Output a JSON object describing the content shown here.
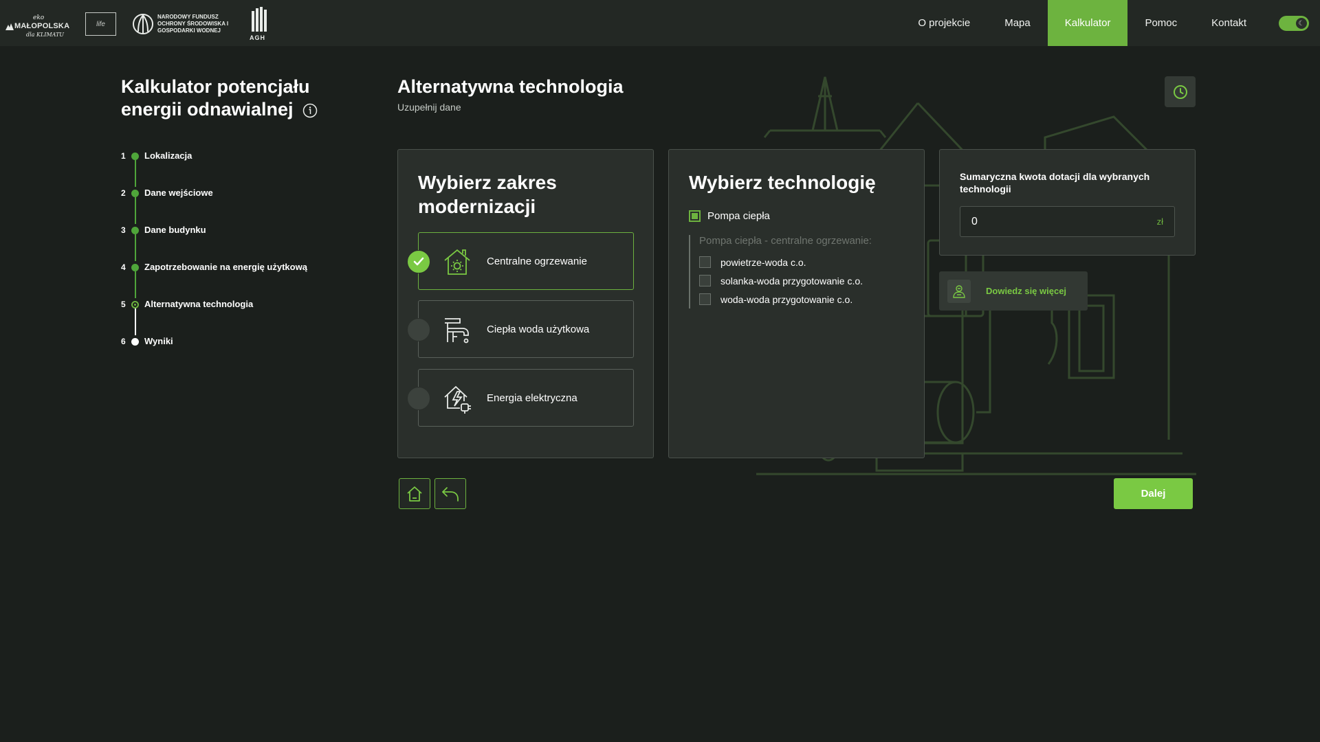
{
  "header": {
    "logos": {
      "malopolska_eko": "eko",
      "malopolska_main": "MAŁOPOLSKA",
      "malopolska_sub": "dla KLIMATU",
      "eu_text": "life",
      "nfos_text": "NARODOWY FUNDUSZ OCHRONY ŚRODOWISKA I GOSPODARKI WODNEJ",
      "agh": "AGH"
    },
    "nav": [
      {
        "label": "O projekcie",
        "active": false
      },
      {
        "label": "Mapa",
        "active": false
      },
      {
        "label": "Kalkulator",
        "active": true
      },
      {
        "label": "Pomoc",
        "active": false
      },
      {
        "label": "Kontakt",
        "active": false
      }
    ],
    "theme_toggle_icon": "moon-icon",
    "theme_toggle_glyph": "☾"
  },
  "sidebar": {
    "title": "Kalkulator potencjału energii odnawialnej",
    "info_icon": "info-icon",
    "steps": [
      {
        "num": "1",
        "label": "Lokalizacja",
        "state": "done"
      },
      {
        "num": "2",
        "label": "Dane wejściowe",
        "state": "done"
      },
      {
        "num": "3",
        "label": "Dane budynku",
        "state": "done"
      },
      {
        "num": "4",
        "label": "Zapotrzebowanie na energię użytkową",
        "state": "done"
      },
      {
        "num": "5",
        "label": "Alternatywna technologia",
        "state": "current"
      },
      {
        "num": "6",
        "label": "Wyniki",
        "state": "todo"
      }
    ]
  },
  "main": {
    "title": "Alternatywna technologia",
    "subtitle": "Uzupełnij dane",
    "history_icon": "clock-icon"
  },
  "modernization": {
    "title": "Wybierz zakres modernizacji",
    "options": [
      {
        "label": "Centralne ogrzewanie",
        "selected": true,
        "icon": "house-heating-icon"
      },
      {
        "label": "Ciepła woda użytkowa",
        "selected": false,
        "icon": "water-tap-icon"
      },
      {
        "label": "Energia elektryczna",
        "selected": false,
        "icon": "house-electric-icon"
      }
    ]
  },
  "technology": {
    "title": "Wybierz technologię",
    "main_option": {
      "label": "Pompa ciepła",
      "checked": true
    },
    "group_title": "Pompa ciepła - centralne ogrzewanie:",
    "sub_options": [
      {
        "label": "powietrze-woda c.o.",
        "checked": false
      },
      {
        "label": "solanka-woda przygotowanie c.o.",
        "checked": false
      },
      {
        "label": "woda-woda przygotowanie c.o.",
        "checked": false
      }
    ]
  },
  "summary": {
    "label": "Sumaryczna kwota dotacji dla wybranych technologii",
    "value": "0",
    "unit": "zł"
  },
  "learn_more": {
    "label": "Dowiedz się więcej",
    "icon": "advisor-icon"
  },
  "actions": {
    "home_icon": "home-icon",
    "back_icon": "undo-arrow-icon",
    "next_label": "Dalej"
  },
  "colors": {
    "accent": "#6db33f",
    "accent_light": "#7ac943",
    "background": "#1b1f1c",
    "card": "#2a2f2b"
  }
}
